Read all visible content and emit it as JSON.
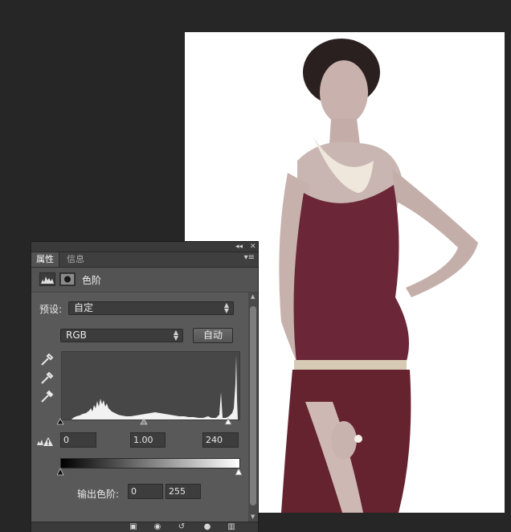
{
  "panel": {
    "tabs": [
      "属性",
      "信息"
    ],
    "active_tab": "属性",
    "title": "色阶",
    "topbar": {
      "collapse_glyph": "◂◂",
      "close_glyph": "✕"
    },
    "menu_glyph": "▾≡"
  },
  "levels": {
    "preset_label": "预设:",
    "preset_value": "自定",
    "channel_value": "RGB",
    "auto_button": "自动",
    "input_black": "0",
    "input_gamma": "1.00",
    "input_white": "240",
    "output_label": "输出色阶:",
    "output_black": "0",
    "output_white": "255"
  },
  "icons": {
    "levels_adjustment": "histogram-icon",
    "mask": "mask-icon",
    "eyedroppers": [
      "black-point-eyedropper-icon",
      "gray-point-eyedropper-icon",
      "white-point-eyedropper-icon"
    ],
    "clipping_warning": "clipping-warning-icon",
    "bottom_bar": [
      "clip-to-layer-icon",
      "view-previous-icon",
      "reset-icon",
      "visibility-icon",
      "trash-icon"
    ]
  },
  "colors": {
    "app_background": "#262626",
    "panel_background": "#535353",
    "dress": "#6b2737"
  }
}
